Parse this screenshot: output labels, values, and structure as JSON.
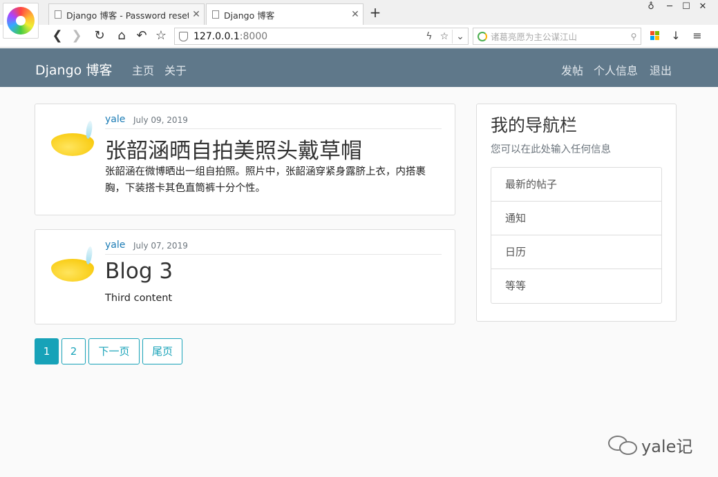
{
  "browser": {
    "tabs": [
      {
        "title": "Django 博客 - Password reset"
      },
      {
        "title": "Django 博客"
      }
    ],
    "new_tab": "+",
    "url_host": "127.0.0.1",
    "url_port": ":8000",
    "search_placeholder": "诸葛亮愿为主公谋江山"
  },
  "site": {
    "brand": "Django 博客",
    "nav_left": [
      "主页",
      "关于"
    ],
    "nav_right": [
      "发帖",
      "个人信息",
      "退出"
    ]
  },
  "posts": [
    {
      "author": "yale",
      "date": "July 09, 2019",
      "title": "张韶涵晒自拍美照头戴草帽",
      "content": "张韶涵在微博晒出一组自拍照。照片中，张韶涵穿紧身露脐上衣，内搭裹胸，下装搭卡其色直筒裤十分个性。"
    },
    {
      "author": "yale",
      "date": "July 07, 2019",
      "title": "Blog 3",
      "content": "Third content"
    }
  ],
  "sidebar": {
    "title": "我的导航栏",
    "subtitle": "您可以在此处输入任何信息",
    "items": [
      "最新的帖子",
      "通知",
      "日历",
      "等等"
    ]
  },
  "pagination": [
    "1",
    "2",
    "下一页",
    "尾页"
  ],
  "watermark": "yale记"
}
